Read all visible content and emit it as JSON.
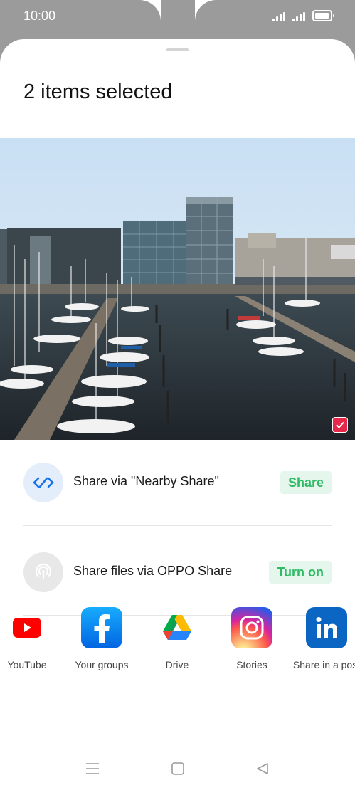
{
  "status_bar": {
    "time": "10:00"
  },
  "sheet": {
    "title": "2 items selected"
  },
  "share_options": [
    {
      "label": "Share via \"Nearby Share\"",
      "action": "Share",
      "icon": "nearby-share-icon"
    },
    {
      "label": "Share files via OPPO Share",
      "action": "Turn on",
      "icon": "oppo-share-icon"
    }
  ],
  "apps": [
    {
      "label": "YouTube",
      "icon": "youtube-icon"
    },
    {
      "label": "Your groups",
      "icon": "facebook-icon"
    },
    {
      "label": "Drive",
      "icon": "google-drive-icon"
    },
    {
      "label": "Stories",
      "icon": "instagram-icon"
    },
    {
      "label": "Share in a post",
      "icon": "linkedin-icon"
    }
  ],
  "colors": {
    "accent_green": "#2fba64",
    "pill_bg": "#e5f7ec",
    "check_red": "#e8284b"
  }
}
